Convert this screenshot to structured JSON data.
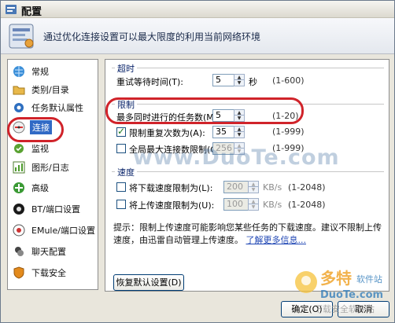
{
  "window": {
    "title": "配置"
  },
  "banner": {
    "text": "通过优化连接设置可以最大限度的利用当前网络环境"
  },
  "sidebar": {
    "items": [
      {
        "label": "常规",
        "icon": "globe-icon"
      },
      {
        "label": "类别/目录",
        "icon": "folder-icon"
      },
      {
        "label": "任务默认属性",
        "icon": "gear-blue-icon"
      },
      {
        "label": "连接",
        "icon": "connection-icon",
        "selected": true
      },
      {
        "label": "监视",
        "icon": "monitor-icon"
      },
      {
        "label": "图形/日志",
        "icon": "chart-icon"
      },
      {
        "label": "高级",
        "icon": "advanced-icon"
      },
      {
        "label": "BT/端口设置",
        "icon": "bt-icon"
      },
      {
        "label": "EMule/端口设置",
        "icon": "emule-icon"
      },
      {
        "label": "聊天配置",
        "icon": "chat-icon"
      },
      {
        "label": "下载安全",
        "icon": "shield-icon"
      }
    ]
  },
  "timeout": {
    "group_label": "超时",
    "retry_label": "重试等待时间(T):",
    "retry_value": "5",
    "retry_unit": "秒",
    "retry_range": "(1-600)"
  },
  "limit": {
    "group_label": "限制",
    "max_tasks_label": "最多同时进行的任务数(M):",
    "max_tasks_value": "5",
    "max_tasks_range": "(1-20)",
    "retry_limit_label": "限制重复次数为(A):",
    "retry_limit_checked": true,
    "retry_limit_value": "35",
    "retry_limit_range": "(1-999)",
    "global_conn_label": "全局最大连接数限制(G)",
    "global_conn_checked": false,
    "global_conn_value": "256",
    "global_conn_range": "(1-999)"
  },
  "speed": {
    "group_label": "速度",
    "down_label": "将下载速度限制为(L):",
    "down_value": "200",
    "down_unit": "KB/s",
    "down_range": "(1-2048)",
    "up_label": "将上传速度限制为(U):",
    "up_value": "100",
    "up_unit": "KB/s",
    "up_range": "(1-2048)"
  },
  "hint": {
    "line1": "提示：限制上传速度可能影响您某些任务的下载速度。建议不限制上传速度，由迅雷自动管理上传速度。",
    "link": "了解更多信息..."
  },
  "buttons": {
    "restore": "恢复默认设置(D)",
    "ok": "确定(O)",
    "cancel": "取消"
  },
  "watermark": {
    "text": "www.DuoTe.com",
    "logo_main": "多特",
    "logo_sub": "软件站",
    "logo_url": "DuoTe.com",
    "logo_tag": "下载安全软件站"
  },
  "colors": {
    "accent_red": "#d0232a",
    "selection": "#316ac5",
    "link": "#1f46b4"
  }
}
